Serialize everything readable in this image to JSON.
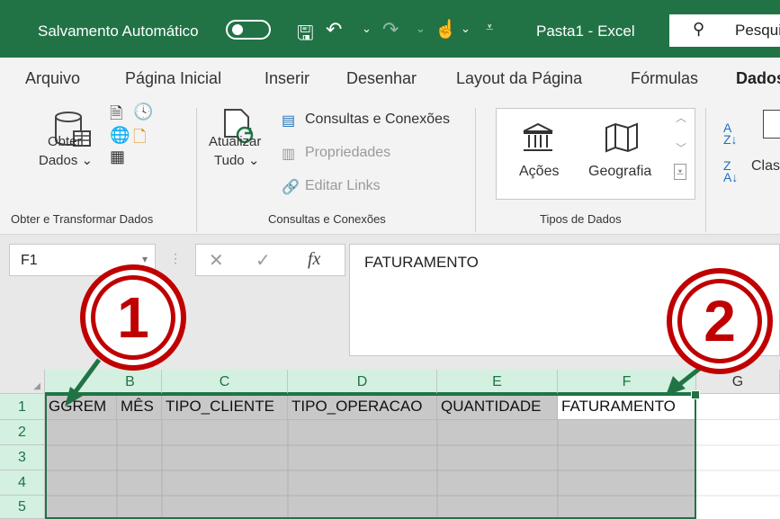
{
  "titlebar": {
    "autosave_label": "Salvamento Automático",
    "autosave_state": "off",
    "workbook": "Pasta1",
    "separator": "-",
    "app": "Excel",
    "search_placeholder": "Pesqui",
    "brand_color": "#217346"
  },
  "menu": {
    "items": [
      "Arquivo",
      "Página Inicial",
      "Inserir",
      "Desenhar",
      "Layout da Página",
      "Fórmulas",
      "Dados"
    ],
    "active": "Dados"
  },
  "ribbon": {
    "get_data": {
      "line1": "Obter",
      "line2": "Dados",
      "arrow": "⌄",
      "group": "Obter e Transformar Dados"
    },
    "queries": {
      "refresh_line1": "Atualizar",
      "refresh_line2": "Tudo",
      "arrow": "⌄",
      "queries_connections": "Consultas e Conexões",
      "properties": "Propriedades",
      "edit_links": "Editar Links",
      "group": "Consultas e Conexões"
    },
    "data_types": {
      "stocks": "Ações",
      "geography": "Geografia",
      "group": "Tipos de Dados"
    },
    "sort": {
      "label": "Class"
    }
  },
  "formula_bar": {
    "name_box": "F1",
    "cancel": "✕",
    "enter": "✓",
    "fx": "fx",
    "value": "FATURAMENTO"
  },
  "grid": {
    "columns": [
      "B",
      "C",
      "D",
      "E",
      "F",
      "G"
    ],
    "rows": [
      "1",
      "2",
      "3",
      "4",
      "5"
    ],
    "row1": [
      "GGREM",
      "MÊS",
      "TIPO_CLIENTE",
      "TIPO_OPERACAO",
      "QUANTIDADE",
      "FATURAMENTO"
    ]
  },
  "annotations": {
    "step1": "1",
    "step2": "2",
    "color": "#c00000"
  }
}
